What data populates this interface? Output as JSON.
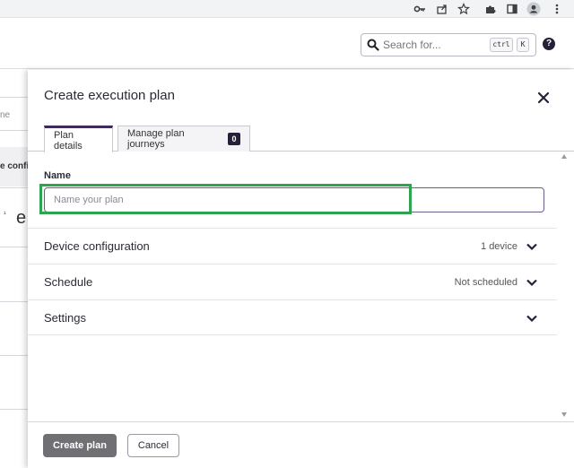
{
  "browser": {
    "icons": [
      "key-icon",
      "share-icon",
      "star-icon",
      "extensions-icon",
      "side-panel-icon",
      "profile-icon",
      "menu-icon"
    ]
  },
  "header": {
    "search": {
      "placeholder": "Search for...",
      "shortcut_keys": [
        "ctrl",
        "K"
      ]
    },
    "help_label": "?"
  },
  "background": {
    "fragments": [
      "ne",
      "e confi",
      "¹",
      "e"
    ]
  },
  "drawer": {
    "title": "Create execution plan",
    "tabs": [
      {
        "label": "Plan details",
        "active": true
      },
      {
        "label": "Manage plan journeys",
        "badge": "0",
        "active": false
      }
    ],
    "name_field": {
      "label": "Name",
      "placeholder": "Name your plan",
      "value": ""
    },
    "sections": [
      {
        "label": "Device configuration",
        "value": "1 device"
      },
      {
        "label": "Schedule",
        "value": "Not scheduled"
      },
      {
        "label": "Settings",
        "value": ""
      }
    ],
    "footer": {
      "primary_label": "Create plan",
      "secondary_label": "Cancel"
    }
  },
  "colors": {
    "brand_dark": "#26203a",
    "tab_accent": "#3b2a5a",
    "highlight": "#2ea44f",
    "primary_button": "#6f6f74"
  }
}
